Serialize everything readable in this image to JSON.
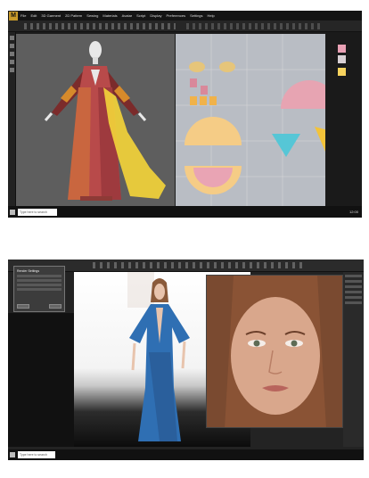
{
  "screenshot1": {
    "app_logo": "M",
    "menu": [
      "File",
      "Edit",
      "3D Garment",
      "2D Pattern",
      "Sewing",
      "Materials",
      "Avatar",
      "Script",
      "Display",
      "Preferences",
      "Settings",
      "Help"
    ],
    "swatch_colors": [
      "#e9a1b5",
      "#d8d0d4",
      "#f7d35e"
    ],
    "search_placeholder": "Type here to search",
    "tray_time": "12:00"
  },
  "screenshot2": {
    "search_placeholder": "Type here to search",
    "dialog_title": "Render Settings",
    "dialog_buttons": [
      "Apply",
      "Cancel"
    ]
  }
}
